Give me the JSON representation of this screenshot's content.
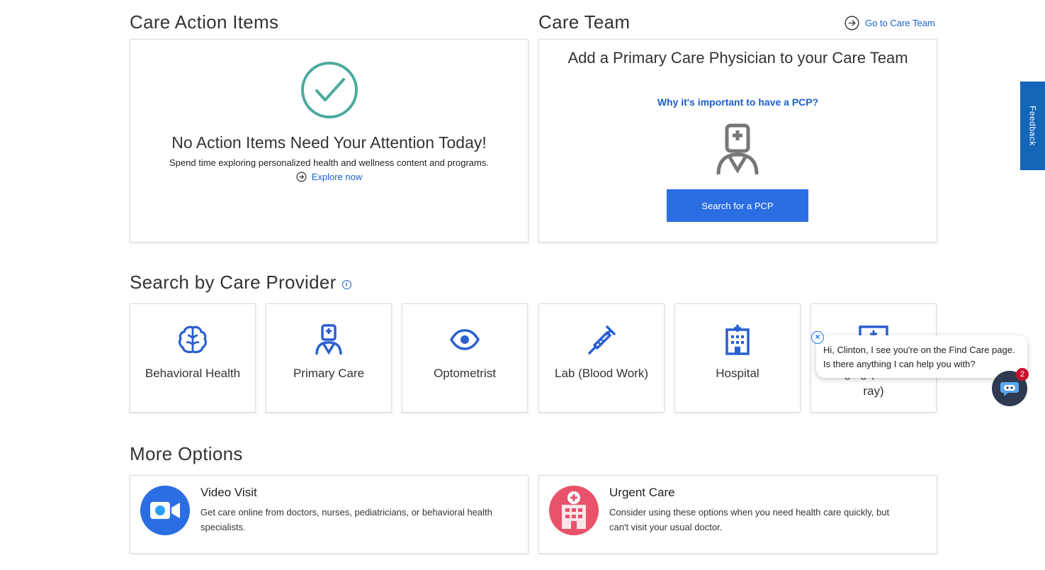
{
  "care_actions": {
    "title": "Care Action Items",
    "headline": "No Action Items Need Your Attention Today!",
    "subtext": "Spend time exploring personalized health and wellness content and programs.",
    "explore_link": "Explore now",
    "check_color": "#4aaa9c"
  },
  "care_team": {
    "title": "Care Team",
    "goto_link": "Go to Care Team",
    "headline": "Add a Primary Care Physician to your Care Team",
    "why_link": "Why it's important to have a PCP?",
    "search_button": "Search for a PCP"
  },
  "search_provider": {
    "title": "Search by Care Provider",
    "info_icon": "i",
    "tiles": [
      {
        "label": "Behavioral Health",
        "icon": "brain-icon"
      },
      {
        "label": "Primary Care",
        "icon": "nurse-icon"
      },
      {
        "label": "Optometrist",
        "icon": "eye-icon"
      },
      {
        "label": "Lab (Blood Work)",
        "icon": "syringe-icon"
      },
      {
        "label": "Hospital",
        "icon": "hospital-icon"
      },
      {
        "label": "Imaging (MRI & X-ray)",
        "icon": "imaging-icon"
      }
    ]
  },
  "more_options": {
    "title": "More Options",
    "items": [
      {
        "title": "Video Visit",
        "desc": "Get care online from doctors, nurses, pediatricians, or behavioral health specialists.",
        "icon": "video-camera-icon",
        "color": "#2b6ee3"
      },
      {
        "title": "Urgent Care",
        "desc": "Consider using these options when you need health care quickly, but can't visit your usual doctor.",
        "icon": "urgent-care-icon",
        "color": "#e8526a"
      }
    ]
  },
  "feedback": {
    "label": "Feedback"
  },
  "chat": {
    "message": "Hi, Clinton, I see you're on the Find Care page. Is there anything I can help you with?",
    "badge_count": "2",
    "close": "×"
  },
  "colors": {
    "link": "#1a5fc7",
    "primary_button": "#2b6ee3",
    "icon_blue": "#2a5fd0",
    "feedback_tab": "#1466b8"
  }
}
